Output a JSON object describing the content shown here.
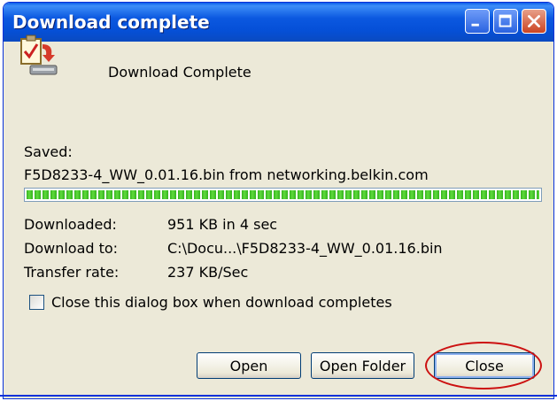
{
  "window": {
    "title": "Download complete"
  },
  "header": {
    "complete_label": "Download Complete"
  },
  "saved": {
    "label": "Saved:",
    "file_line": "F5D8233-4_WW_0.01.16.bin from networking.belkin.com"
  },
  "progress": {
    "percent": 100,
    "color": "#35b21e"
  },
  "details": {
    "downloaded_label": "Downloaded:",
    "downloaded_value": "951 KB in 4 sec",
    "download_to_label": "Download to:",
    "download_to_value": "C:\\Docu...\\F5D8233-4_WW_0.01.16.bin",
    "transfer_rate_label": "Transfer rate:",
    "transfer_rate_value": "237 KB/Sec"
  },
  "options": {
    "close_checkbox_label": "Close this dialog box when download completes",
    "close_checked": false
  },
  "buttons": {
    "open": "Open",
    "open_folder": "Open Folder",
    "close": "Close"
  },
  "icons": {
    "download": "download-complete-icon",
    "minimize": "minimize-icon",
    "maximize": "maximize-icon",
    "close": "close-icon"
  },
  "colors": {
    "titlebar": "#0550d8",
    "dialog_bg": "#ece9d8",
    "highlight": "#cc1111"
  }
}
